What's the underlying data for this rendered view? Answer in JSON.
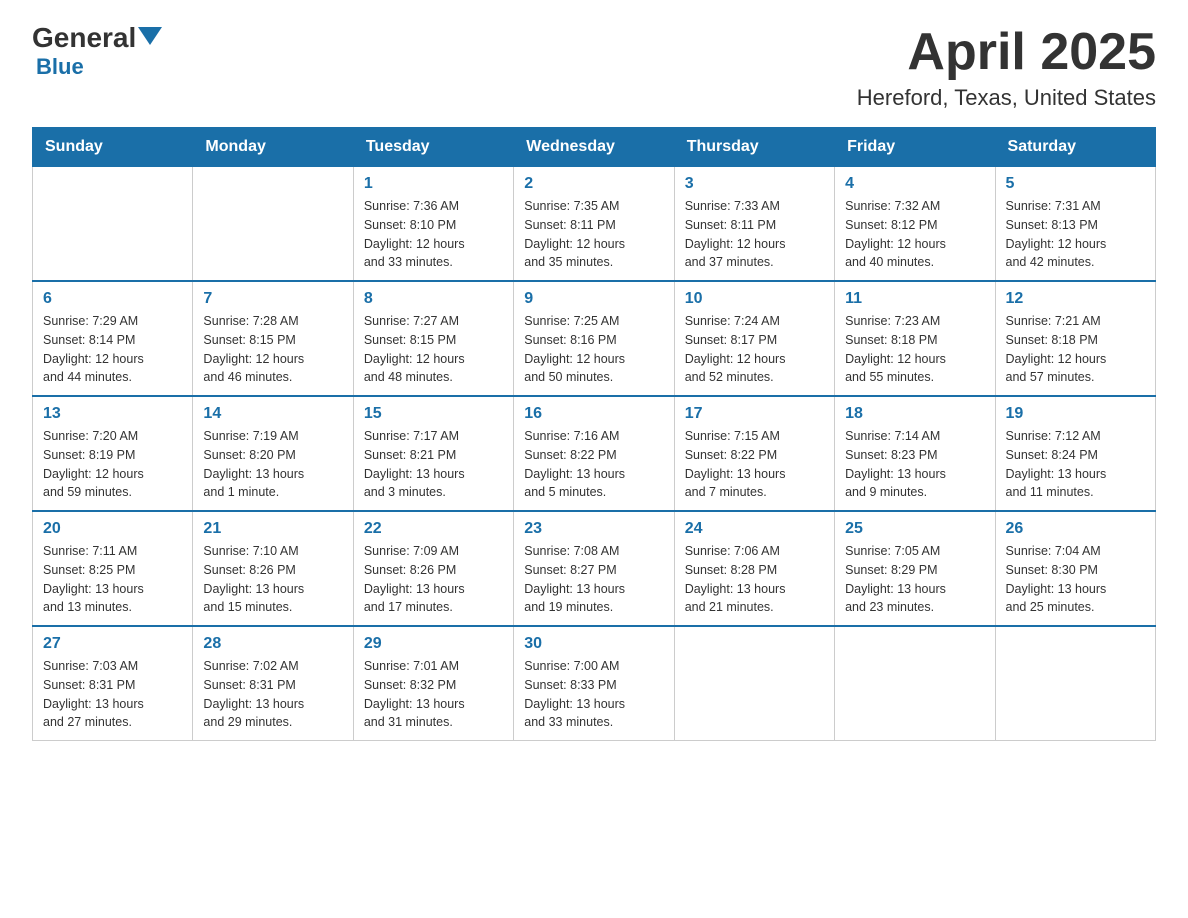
{
  "logo": {
    "general": "General",
    "blue": "Blue",
    "subtitle": "Blue"
  },
  "header": {
    "month_year": "April 2025",
    "location": "Hereford, Texas, United States"
  },
  "days_of_week": [
    "Sunday",
    "Monday",
    "Tuesday",
    "Wednesday",
    "Thursday",
    "Friday",
    "Saturday"
  ],
  "weeks": [
    [
      {
        "day": "",
        "info": ""
      },
      {
        "day": "",
        "info": ""
      },
      {
        "day": "1",
        "info": "Sunrise: 7:36 AM\nSunset: 8:10 PM\nDaylight: 12 hours\nand 33 minutes."
      },
      {
        "day": "2",
        "info": "Sunrise: 7:35 AM\nSunset: 8:11 PM\nDaylight: 12 hours\nand 35 minutes."
      },
      {
        "day": "3",
        "info": "Sunrise: 7:33 AM\nSunset: 8:11 PM\nDaylight: 12 hours\nand 37 minutes."
      },
      {
        "day": "4",
        "info": "Sunrise: 7:32 AM\nSunset: 8:12 PM\nDaylight: 12 hours\nand 40 minutes."
      },
      {
        "day": "5",
        "info": "Sunrise: 7:31 AM\nSunset: 8:13 PM\nDaylight: 12 hours\nand 42 minutes."
      }
    ],
    [
      {
        "day": "6",
        "info": "Sunrise: 7:29 AM\nSunset: 8:14 PM\nDaylight: 12 hours\nand 44 minutes."
      },
      {
        "day": "7",
        "info": "Sunrise: 7:28 AM\nSunset: 8:15 PM\nDaylight: 12 hours\nand 46 minutes."
      },
      {
        "day": "8",
        "info": "Sunrise: 7:27 AM\nSunset: 8:15 PM\nDaylight: 12 hours\nand 48 minutes."
      },
      {
        "day": "9",
        "info": "Sunrise: 7:25 AM\nSunset: 8:16 PM\nDaylight: 12 hours\nand 50 minutes."
      },
      {
        "day": "10",
        "info": "Sunrise: 7:24 AM\nSunset: 8:17 PM\nDaylight: 12 hours\nand 52 minutes."
      },
      {
        "day": "11",
        "info": "Sunrise: 7:23 AM\nSunset: 8:18 PM\nDaylight: 12 hours\nand 55 minutes."
      },
      {
        "day": "12",
        "info": "Sunrise: 7:21 AM\nSunset: 8:18 PM\nDaylight: 12 hours\nand 57 minutes."
      }
    ],
    [
      {
        "day": "13",
        "info": "Sunrise: 7:20 AM\nSunset: 8:19 PM\nDaylight: 12 hours\nand 59 minutes."
      },
      {
        "day": "14",
        "info": "Sunrise: 7:19 AM\nSunset: 8:20 PM\nDaylight: 13 hours\nand 1 minute."
      },
      {
        "day": "15",
        "info": "Sunrise: 7:17 AM\nSunset: 8:21 PM\nDaylight: 13 hours\nand 3 minutes."
      },
      {
        "day": "16",
        "info": "Sunrise: 7:16 AM\nSunset: 8:22 PM\nDaylight: 13 hours\nand 5 minutes."
      },
      {
        "day": "17",
        "info": "Sunrise: 7:15 AM\nSunset: 8:22 PM\nDaylight: 13 hours\nand 7 minutes."
      },
      {
        "day": "18",
        "info": "Sunrise: 7:14 AM\nSunset: 8:23 PM\nDaylight: 13 hours\nand 9 minutes."
      },
      {
        "day": "19",
        "info": "Sunrise: 7:12 AM\nSunset: 8:24 PM\nDaylight: 13 hours\nand 11 minutes."
      }
    ],
    [
      {
        "day": "20",
        "info": "Sunrise: 7:11 AM\nSunset: 8:25 PM\nDaylight: 13 hours\nand 13 minutes."
      },
      {
        "day": "21",
        "info": "Sunrise: 7:10 AM\nSunset: 8:26 PM\nDaylight: 13 hours\nand 15 minutes."
      },
      {
        "day": "22",
        "info": "Sunrise: 7:09 AM\nSunset: 8:26 PM\nDaylight: 13 hours\nand 17 minutes."
      },
      {
        "day": "23",
        "info": "Sunrise: 7:08 AM\nSunset: 8:27 PM\nDaylight: 13 hours\nand 19 minutes."
      },
      {
        "day": "24",
        "info": "Sunrise: 7:06 AM\nSunset: 8:28 PM\nDaylight: 13 hours\nand 21 minutes."
      },
      {
        "day": "25",
        "info": "Sunrise: 7:05 AM\nSunset: 8:29 PM\nDaylight: 13 hours\nand 23 minutes."
      },
      {
        "day": "26",
        "info": "Sunrise: 7:04 AM\nSunset: 8:30 PM\nDaylight: 13 hours\nand 25 minutes."
      }
    ],
    [
      {
        "day": "27",
        "info": "Sunrise: 7:03 AM\nSunset: 8:31 PM\nDaylight: 13 hours\nand 27 minutes."
      },
      {
        "day": "28",
        "info": "Sunrise: 7:02 AM\nSunset: 8:31 PM\nDaylight: 13 hours\nand 29 minutes."
      },
      {
        "day": "29",
        "info": "Sunrise: 7:01 AM\nSunset: 8:32 PM\nDaylight: 13 hours\nand 31 minutes."
      },
      {
        "day": "30",
        "info": "Sunrise: 7:00 AM\nSunset: 8:33 PM\nDaylight: 13 hours\nand 33 minutes."
      },
      {
        "day": "",
        "info": ""
      },
      {
        "day": "",
        "info": ""
      },
      {
        "day": "",
        "info": ""
      }
    ]
  ]
}
